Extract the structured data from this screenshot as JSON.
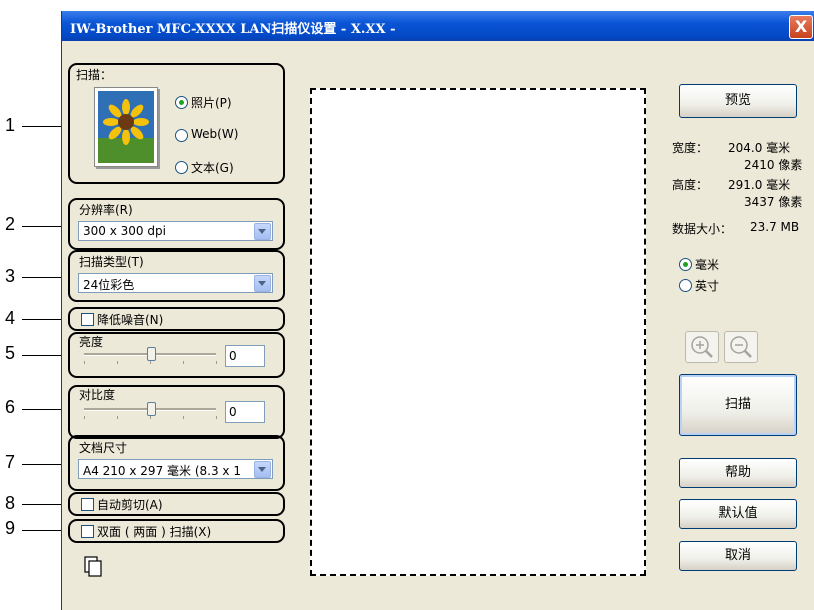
{
  "window": {
    "title": "IW-Brother MFC-XXXX LAN扫描仪设置 - X.XX -",
    "close_label": "X"
  },
  "callouts": [
    "1",
    "2",
    "3",
    "4",
    "5",
    "6",
    "7",
    "8",
    "9"
  ],
  "scan": {
    "label": "扫描：",
    "options": [
      {
        "label": "照片(P)",
        "selected": true
      },
      {
        "label": "Web(W)",
        "selected": false
      },
      {
        "label": "文本(G)",
        "selected": false
      }
    ]
  },
  "resolution": {
    "label": "分辨率(R)",
    "value": "300 x 300 dpi"
  },
  "scan_type": {
    "label": "扫描类型(T)",
    "value": "24位彩色"
  },
  "noise": {
    "label": "降低噪音(N)",
    "checked": false
  },
  "brightness": {
    "label": "亮度",
    "value": "0"
  },
  "contrast": {
    "label": "对比度",
    "value": "0"
  },
  "doc_size": {
    "label": "文档尺寸",
    "value": "A4 210 x 297 毫米 (8.3 x 1"
  },
  "auto_crop": {
    "label": "自动剪切(A)",
    "checked": false
  },
  "duplex": {
    "label": "双面 ( 两面 ) 扫描(X)",
    "checked": false
  },
  "right": {
    "preview_label": "预览",
    "width_label": "宽度：",
    "width_mm": "204.0 毫米",
    "width_px": "2410 像素",
    "height_label": "高度：",
    "height_mm": "291.0 毫米",
    "height_px": "3437 像素",
    "datasize_label": "数据大小：",
    "datasize_value": "23.7 MB",
    "unit_mm": "毫米",
    "unit_inch": "英寸",
    "scan_label": "扫描",
    "help_label": "帮助",
    "default_label": "默认值",
    "cancel_label": "取消"
  },
  "colors": {
    "titlebar": "#0a55d6",
    "dialog_bg": "#ece9d8",
    "radio_dot": "#21a121"
  }
}
